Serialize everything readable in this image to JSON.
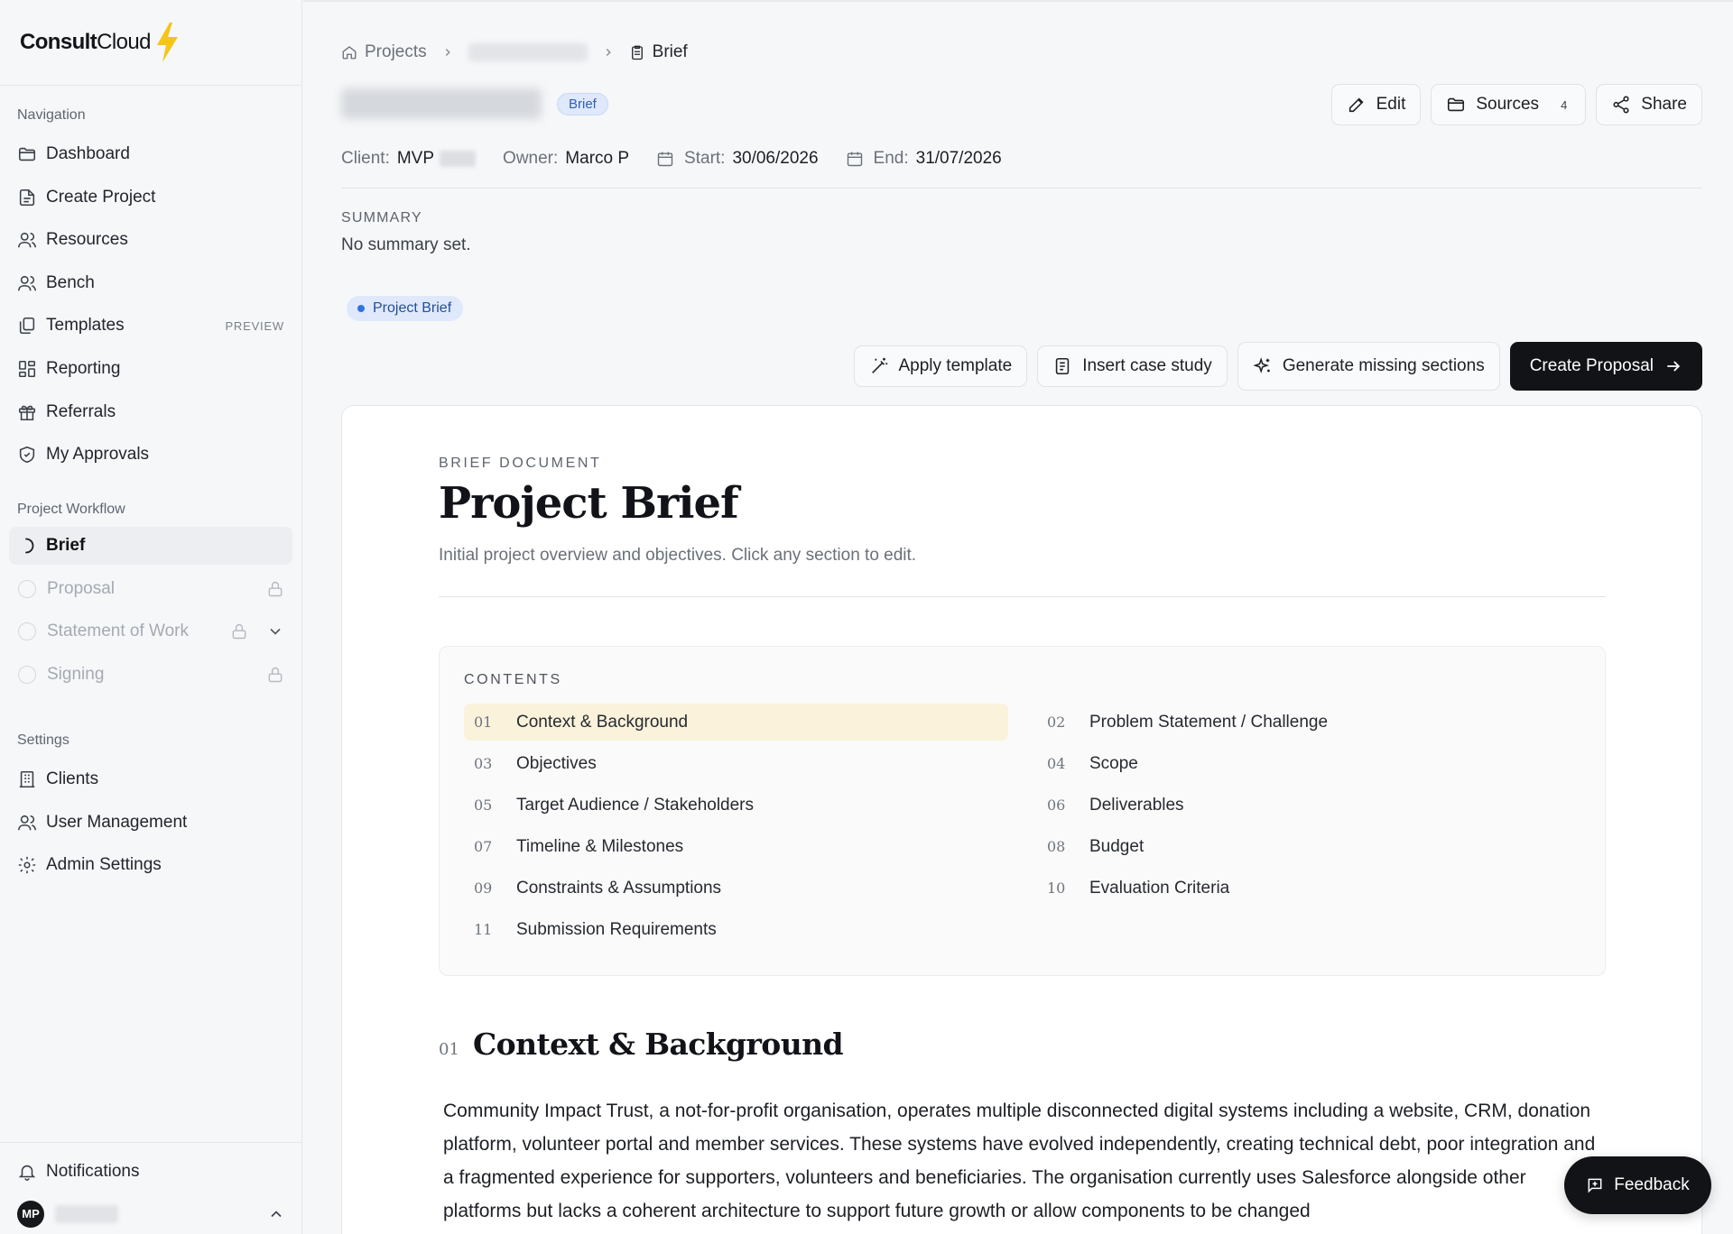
{
  "brand": {
    "name_bold": "Consult",
    "name_light": "Cloud",
    "logo_icon": "lightning-bolt-icon",
    "accent": "#f5c518"
  },
  "sidebar": {
    "navigation_heading": "Navigation",
    "navigation": [
      {
        "label": "Dashboard",
        "icon": "folder-icon"
      },
      {
        "label": "Create Project",
        "icon": "file-icon"
      },
      {
        "label": "Resources",
        "icon": "users-icon"
      },
      {
        "label": "Bench",
        "icon": "users-icon"
      },
      {
        "label": "Templates",
        "icon": "copy-icon",
        "tag": "PREVIEW"
      },
      {
        "label": "Reporting",
        "icon": "grid-icon"
      },
      {
        "label": "Referrals",
        "icon": "gift-icon"
      },
      {
        "label": "My Approvals",
        "icon": "shield-check-icon"
      }
    ],
    "workflow_heading": "Project Workflow",
    "workflow": [
      {
        "label": "Brief",
        "state": "active"
      },
      {
        "label": "Proposal",
        "state": "locked"
      },
      {
        "label": "Statement of Work",
        "state": "locked"
      },
      {
        "label": "Signing",
        "state": "locked"
      }
    ],
    "settings_heading": "Settings",
    "settings": [
      {
        "label": "Clients",
        "icon": "building-icon"
      },
      {
        "label": "User Management",
        "icon": "users-icon"
      },
      {
        "label": "Admin Settings",
        "icon": "gear-icon"
      }
    ],
    "notifications": "Notifications",
    "user_initials": "MP"
  },
  "header": {
    "breadcrumb_root": "Projects",
    "breadcrumb_current": "Brief",
    "status_badge": "Brief",
    "actions": {
      "edit": "Edit",
      "sources": "Sources",
      "sources_count": "4",
      "share": "Share"
    },
    "meta": {
      "client_label": "Client:",
      "client_value": "MVP",
      "owner_label": "Owner:",
      "owner_value": "Marco P",
      "start_label": "Start:",
      "start_value": "30/06/2026",
      "end_label": "End:",
      "end_value": "31/07/2026"
    },
    "summary_label": "SUMMARY",
    "summary_text": "No summary set.",
    "doc_pill": "Project Brief"
  },
  "toolbar": {
    "apply_template": "Apply template",
    "insert_case_study": "Insert case study",
    "generate_missing": "Generate missing sections",
    "create_proposal": "Create Proposal"
  },
  "document": {
    "eyebrow": "BRIEF DOCUMENT",
    "title": "Project Brief",
    "subtitle": "Initial project overview and objectives. Click any section to edit.",
    "contents_label": "CONTENTS",
    "toc": [
      {
        "num": "01",
        "label": "Context & Background"
      },
      {
        "num": "02",
        "label": "Problem Statement / Challenge"
      },
      {
        "num": "03",
        "label": "Objectives"
      },
      {
        "num": "04",
        "label": "Scope"
      },
      {
        "num": "05",
        "label": "Target Audience / Stakeholders"
      },
      {
        "num": "06",
        "label": "Deliverables"
      },
      {
        "num": "07",
        "label": "Timeline & Milestones"
      },
      {
        "num": "08",
        "label": "Budget"
      },
      {
        "num": "09",
        "label": "Constraints & Assumptions"
      },
      {
        "num": "10",
        "label": "Evaluation Criteria"
      },
      {
        "num": "11",
        "label": "Submission Requirements"
      }
    ],
    "section_num": "01",
    "section_title": "Context & Background",
    "section_body": "Community Impact Trust, a not-for-profit organisation, operates multiple disconnected digital systems including a website, CRM, donation platform, volunteer portal and member services. These systems have evolved independently, creating technical debt, poor integration and a fragmented experience for supporters, volunteers and beneficiaries. The organisation currently uses Salesforce alongside other platforms but lacks a coherent architecture to support future growth or allow components to be changed"
  },
  "feedback": "Feedback"
}
